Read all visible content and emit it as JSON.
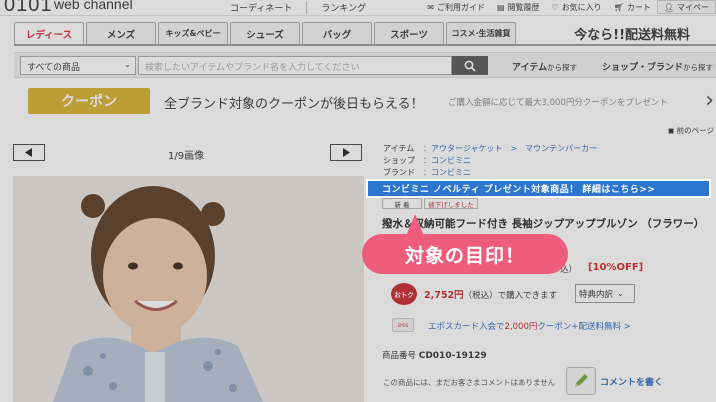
{
  "header": {
    "logo": "0101",
    "logo_sub": "web channel",
    "nav": [
      "コーディネート",
      "ランキング"
    ],
    "util": [
      "ご利用ガイド",
      "閲覧履歴",
      "お気に入り",
      "カート",
      "マイペー"
    ]
  },
  "categories": [
    {
      "label": "レディース",
      "active": true
    },
    {
      "label": "メンズ",
      "active": false
    },
    {
      "label": "キッズ&ベビー",
      "active": false
    },
    {
      "label": "シューズ",
      "active": false
    },
    {
      "label": "バッグ",
      "active": false
    },
    {
      "label": "スポーツ",
      "active": false
    },
    {
      "label": "コスメ·生活雑貨",
      "active": false
    }
  ],
  "promo_head": "今なら!!配送料無料",
  "search": {
    "scope": "すべての商品",
    "placeholder": "検索したいアイテムやブランド名を入力してください",
    "link_item": "アイテム",
    "link_item_suffix": "から探す",
    "link_shop": "ショップ・ブランド",
    "link_shop_suffix": "から探す"
  },
  "coupon": {
    "button": "クーポン",
    "text": "全ブランド対象のクーポンが後日もらえる！",
    "sub": "ご購入金額に応じて最大3,000円分クーポンをプレゼント"
  },
  "prev_page": "前のページ",
  "viewer": {
    "counter": "1/9画像"
  },
  "product": {
    "meta": [
      {
        "key": "アイテム",
        "value": "：アウタージャケット　>　マウンテンパーカー"
      },
      {
        "key": "ショップ",
        "value": "：コンビミニ"
      },
      {
        "key": "ブランド",
        "value": "：コンビミニ"
      }
    ],
    "novelty": "コンビミニ ノベルティ プレゼント対象商品！ 詳細はこちら>>",
    "badge_new": "新 着",
    "badge_price": "値下げしました",
    "title": "撥水＆収納可能フード付き 長袖ジップアップブルゾン （フラワー）",
    "tax": "込）",
    "discount": "[10%OFF]",
    "otoku": "おトク",
    "deal_price": "2,752円",
    "deal_suffix": "（税込）で購入できます",
    "perks": "特典内訳",
    "epos_card_label": "EPOS",
    "epos_text_a": "エポスカード入会で",
    "epos_text_b": "2,000円",
    "epos_text_c": "クーポン+配送料無料 >",
    "number_label": "商品番号",
    "number": "CD010-19129",
    "review_note": "この商品には、まだお客さまコメントはありません",
    "comment_link": "コメントを書く"
  },
  "callout": "対象の目印！",
  "colors": {
    "accent_red": "#c9252c",
    "link_blue": "#2a6bc1",
    "coupon_gold": "#d8b12e",
    "callout_pink": "#ee5d7c",
    "novelty_blue": "#2d76cf"
  }
}
